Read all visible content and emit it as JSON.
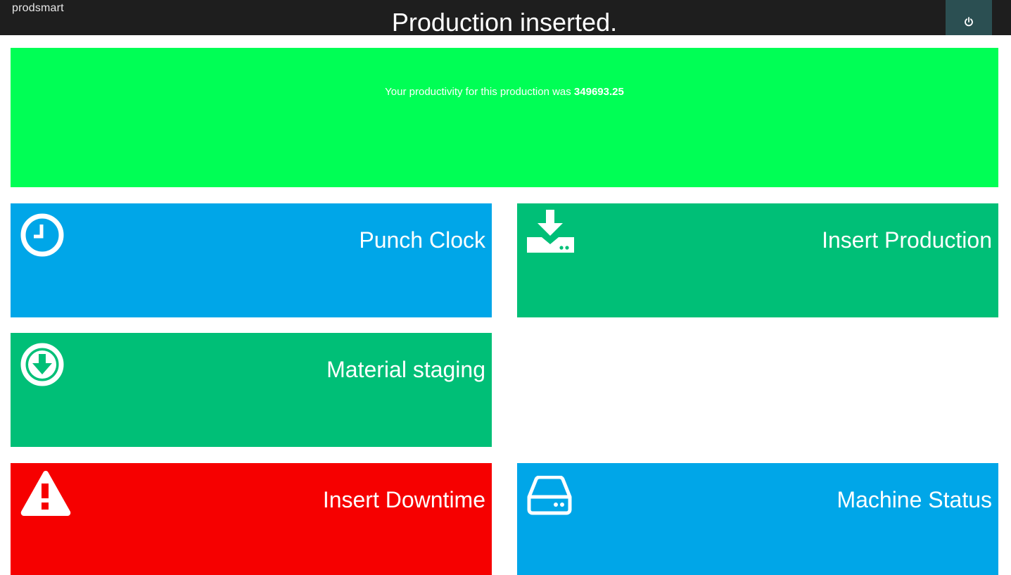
{
  "header": {
    "brand": "prodsmart",
    "power_icon": "power-icon",
    "colors": {
      "background": "#1e1e1e",
      "power_button": "#2b4f52"
    }
  },
  "banner": {
    "title": "Production inserted.",
    "subtitle_prefix": "Your productivity for this production was",
    "productivity_value": "349693.25",
    "color": "#00ff55"
  },
  "tiles": [
    {
      "label": "Punch Clock",
      "icon": "clock-icon",
      "color": "#00a6e8"
    },
    {
      "label": "Insert Production",
      "icon": "download-tray-icon",
      "color": "#00bf77"
    },
    {
      "label": "Material staging",
      "icon": "arrow-down-circle-icon",
      "color": "#00bf77"
    },
    {
      "label": "Insert Downtime",
      "icon": "warning-icon",
      "color": "#f60000"
    },
    {
      "label": "Machine Status",
      "icon": "hard-drive-icon",
      "color": "#00a6e8"
    }
  ]
}
